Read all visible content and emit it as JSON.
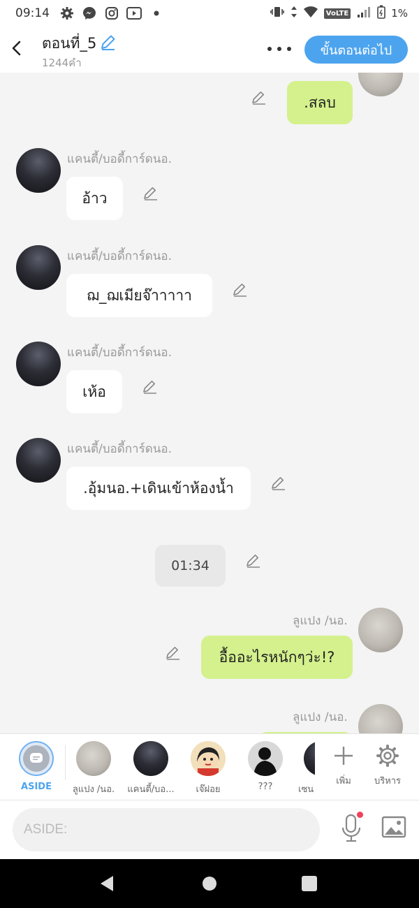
{
  "status_bar": {
    "time": "09:14",
    "network": "VoLTE",
    "battery": "1%"
  },
  "header": {
    "title": "ตอนที่_5",
    "word_count": "1244คำ",
    "next_button": "ขั้นตอนต่อไป"
  },
  "messages": [
    {
      "side": "right",
      "speaker": "",
      "text": ".สลบ"
    },
    {
      "side": "left",
      "speaker": "แคนตี้/บอดี้การ์ดนอ.",
      "text": "อ้าว"
    },
    {
      "side": "left",
      "speaker": "แคนตี้/บอดี้การ์ดนอ.",
      "text": "ฌ_ฌเมียจ๊าาาาา"
    },
    {
      "side": "left",
      "speaker": "แคนตี้/บอดี้การ์ดนอ.",
      "text": "เห้อ"
    },
    {
      "side": "left",
      "speaker": "แคนตี้/บอดี้การ์ดนอ.",
      "text": ".อุ้มนอ.+เดินเข้าห้องน้ำ"
    },
    {
      "side": "center",
      "speaker": "",
      "text": "01:34"
    },
    {
      "side": "right",
      "speaker": "ลูแปง /นอ.",
      "text": "อื้ออะไรหนักๆว่ะ!?"
    },
    {
      "side": "right",
      "speaker": "ลูแปง /นอ.",
      "text": ""
    }
  ],
  "characters": {
    "aside": "ASIDE",
    "list": [
      {
        "name": "ลูแปง /นอ.",
        "avatar": "light"
      },
      {
        "name": "แคนตี้/บอ...",
        "avatar": "dark"
      },
      {
        "name": "เจ๊ฝอย",
        "avatar": "cartoon"
      },
      {
        "name": "???",
        "avatar": "silhouette"
      },
      {
        "name": "เซน",
        "avatar": "dark"
      }
    ],
    "add_label": "เพิ่ม",
    "manage_label": "บริหาร"
  },
  "input": {
    "placeholder": "ASIDE:"
  },
  "colors": {
    "accent": "#4da4ee",
    "my_bubble": "#d4f18d",
    "other_bubble": "#ffffff"
  }
}
